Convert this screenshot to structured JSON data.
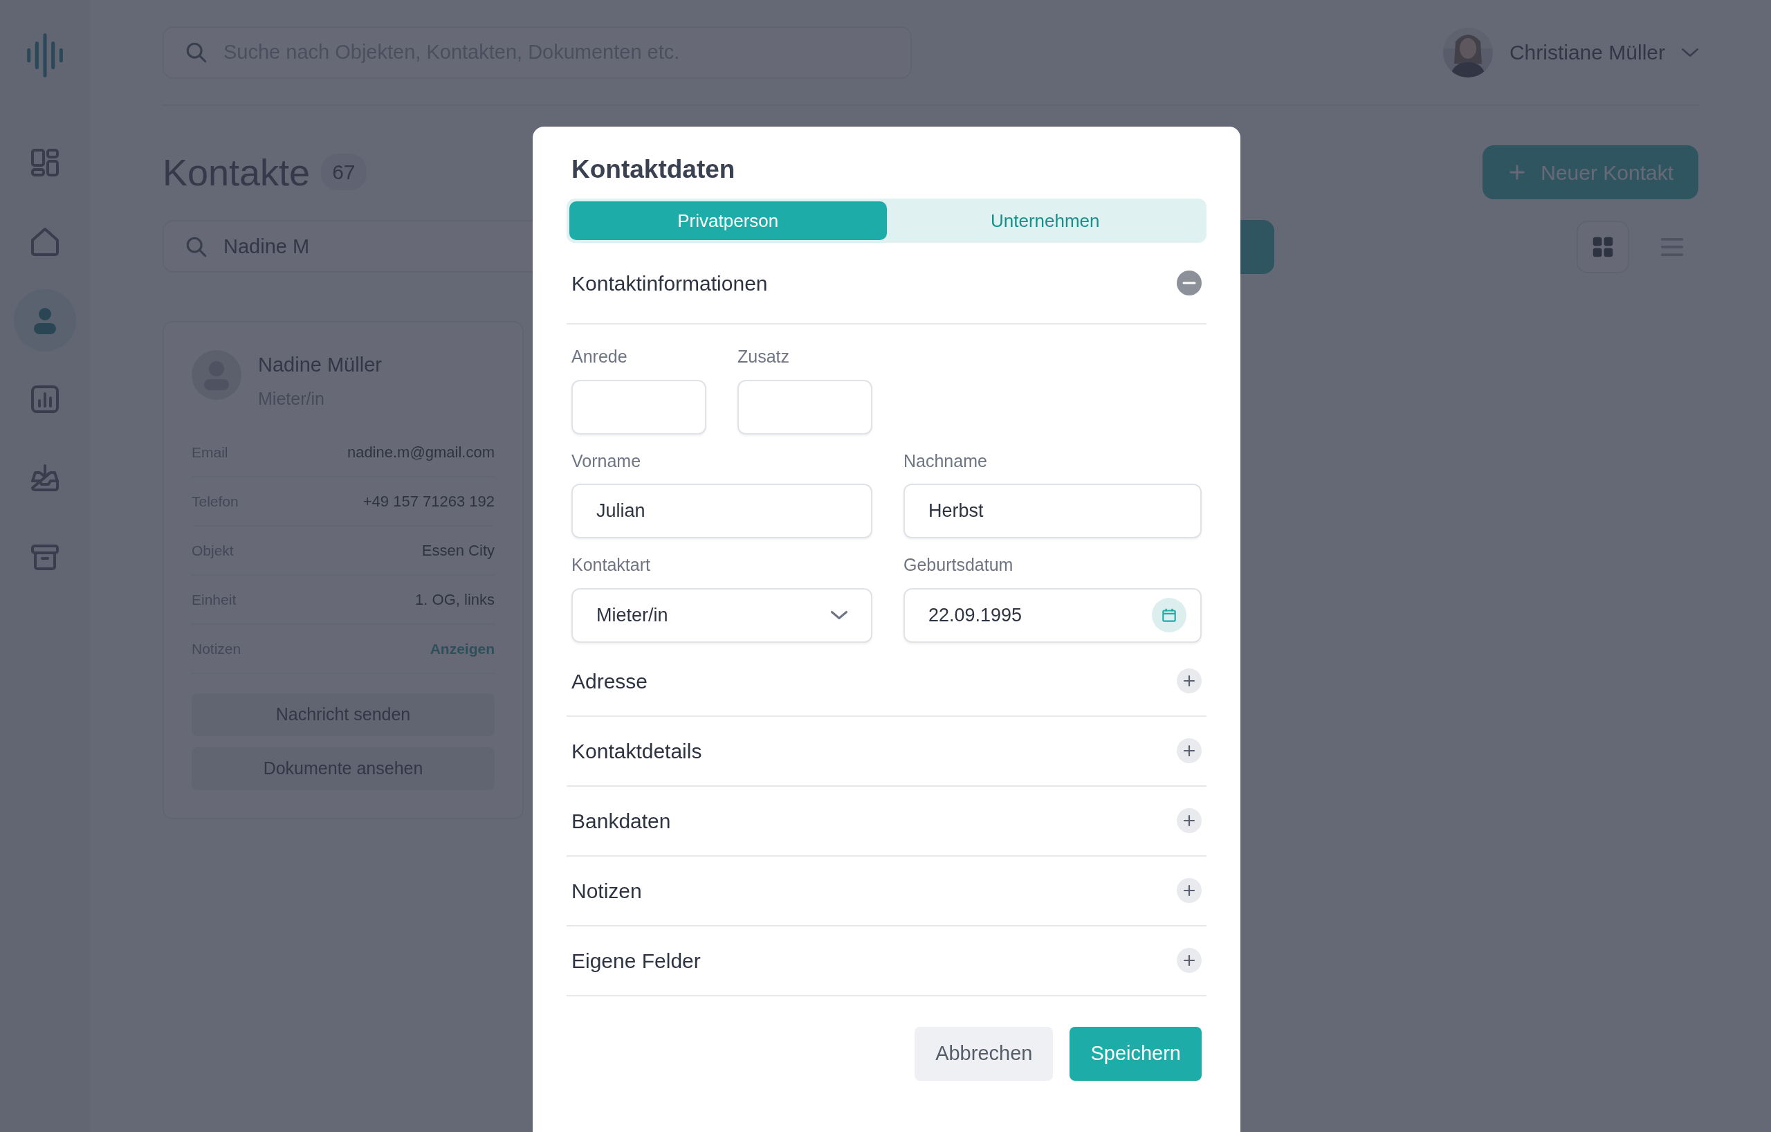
{
  "sidebar": {
    "items": [
      {
        "kind": "dashboard",
        "selected": false
      },
      {
        "kind": "home",
        "selected": false
      },
      {
        "kind": "person",
        "selected": true
      },
      {
        "kind": "chart",
        "selected": false
      },
      {
        "kind": "inbox",
        "selected": false
      },
      {
        "kind": "archive",
        "selected": false
      }
    ]
  },
  "header": {
    "search": {
      "placeholder": "Suche nach Objekten, Kontakten, Dokumenten etc."
    },
    "user": {
      "name": "Christiane Müller"
    }
  },
  "page": {
    "title": "Kontakte",
    "count": "67",
    "new_button": "Neuer Kontakt",
    "search": {
      "value": "Nadine M"
    },
    "views": [
      {
        "kind": "grid",
        "selected": true
      },
      {
        "kind": "list",
        "selected": false
      }
    ]
  },
  "contact_card": {
    "name": "Nadine Müller",
    "role": "Mieter/in",
    "fields": [
      {
        "label": "Email",
        "value": "nadine.m@gmail.com",
        "kind": "text"
      },
      {
        "label": "Telefon",
        "value": "+49 157 71263 192",
        "kind": "text"
      },
      {
        "label": "Objekt",
        "value": "Essen City",
        "kind": "text"
      },
      {
        "label": "Einheit",
        "value": "1. OG, links",
        "kind": "text"
      },
      {
        "label": "Notizen",
        "value": "Anzeigen",
        "kind": "link"
      }
    ],
    "buttons": [
      "Nachricht senden",
      "Dokumente ansehen"
    ]
  },
  "modal": {
    "title": "Kontaktdaten",
    "tabs": [
      {
        "label": "Privatperson",
        "selected": true
      },
      {
        "label": "Unternehmen",
        "selected": false
      }
    ],
    "sections": [
      {
        "title": "Kontaktinformationen",
        "expanded": true,
        "fields": [
          {
            "label": "Anrede",
            "kind": "short"
          },
          {
            "label": "Zusatz",
            "kind": "short"
          },
          {
            "label": "Vorname",
            "kind": "text",
            "value": "Julian"
          },
          {
            "label": "Nachname",
            "kind": "text",
            "value": "Herbst"
          },
          {
            "label": "Kontaktart",
            "kind": "select",
            "value": "Mieter/in"
          },
          {
            "label": "Geburtsdatum",
            "kind": "date",
            "value": "22.09.1995"
          }
        ]
      },
      {
        "title": "Adresse",
        "expanded": false
      },
      {
        "title": "Kontaktdetails",
        "expanded": false
      },
      {
        "title": "Bankdaten",
        "expanded": false
      },
      {
        "title": "Notizen",
        "expanded": false
      },
      {
        "title": "Eigene Felder",
        "expanded": false
      }
    ],
    "buttons": [
      {
        "label": "Abbrechen",
        "kind": "secondary"
      },
      {
        "label": "Speichern",
        "kind": "primary"
      }
    ]
  }
}
